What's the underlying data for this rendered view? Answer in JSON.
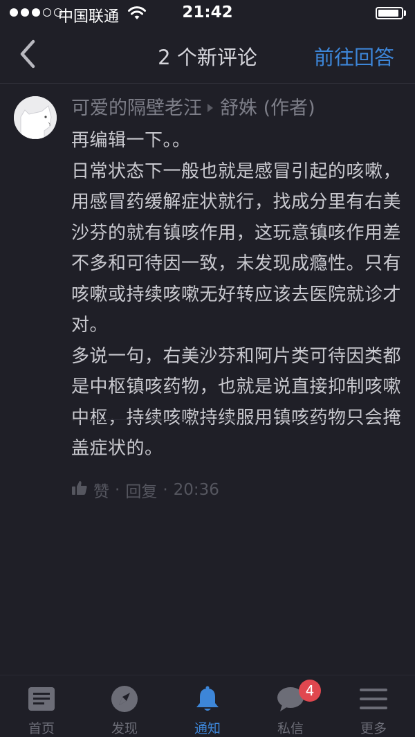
{
  "status_bar": {
    "signal_full": 3,
    "signal_total": 5,
    "carrier": "中国联通",
    "time": "21:42",
    "battery_level": 0.9
  },
  "nav": {
    "title": "2 个新评论",
    "action_label": "前往回答",
    "back_icon": "chevron-left-icon"
  },
  "comment": {
    "author": "可爱的隔壁老汪",
    "reply_to": "舒姝 (作者)",
    "lines": [
      "再编辑一下。。",
      "日常状态下一般也就是感冒引起的咳嗽，用感冒药缓解症状就行，找成分里有右美沙芬的就有镇咳作用，这玩意镇咳作用差不多和可待因一致，未发现成瘾性。只有咳嗽或持续咳嗽无好转应该去医院就诊才对。",
      "多说一句，右美沙芬和阿片类可待因类都是中枢镇咳药物，也就是说直接抑制咳嗽中枢，持续咳嗽持续服用镇咳药物只会掩盖症状的。"
    ],
    "like_label": "赞",
    "reply_label": "回复",
    "separator": "·",
    "timestamp": "20:36"
  },
  "tab_bar": {
    "items": [
      {
        "label": "首页",
        "icon": "home-icon"
      },
      {
        "label": "发现",
        "icon": "compass-icon"
      },
      {
        "label": "通知",
        "icon": "bell-icon"
      },
      {
        "label": "私信",
        "icon": "chat-bubble-icon",
        "badge": "4"
      },
      {
        "label": "更多",
        "icon": "menu-icon"
      }
    ],
    "active_index": 2
  },
  "colors": {
    "background": "#1f1f27",
    "accent": "#3d86d8",
    "badge": "#e0474f",
    "text": "#c9c9cf",
    "muted": "#7d7e88"
  }
}
